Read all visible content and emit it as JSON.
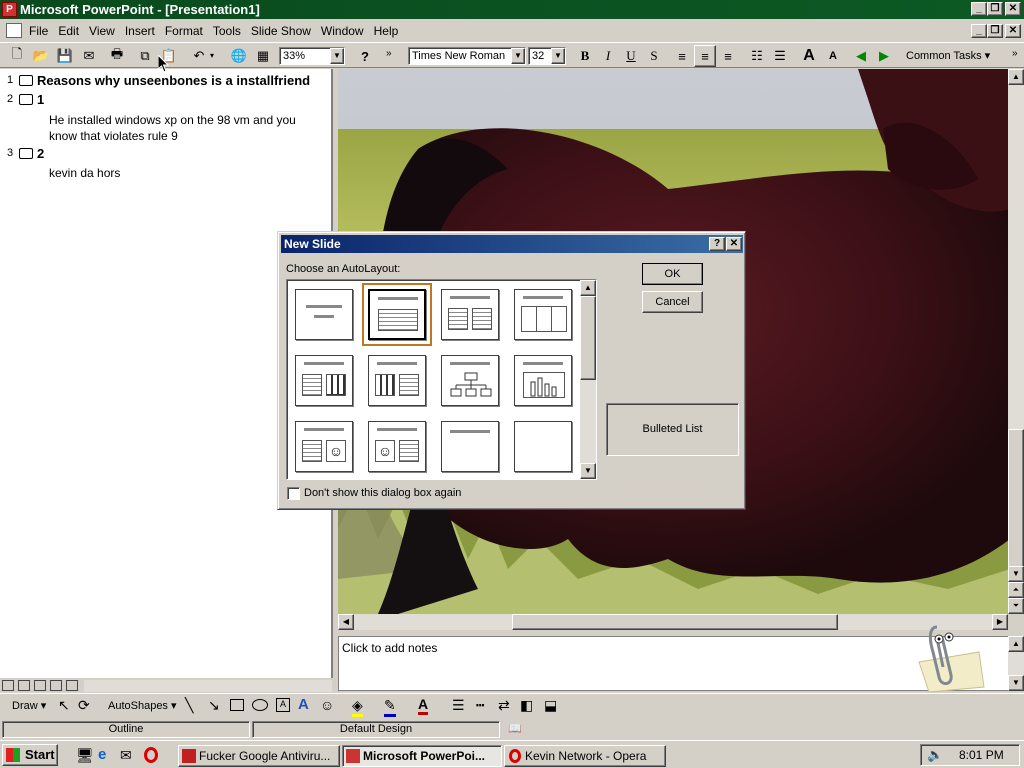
{
  "app": {
    "title": "Microsoft PowerPoint - [Presentation1]"
  },
  "menu": [
    "File",
    "Edit",
    "View",
    "Insert",
    "Format",
    "Tools",
    "Slide Show",
    "Window",
    "Help"
  ],
  "toolbar": {
    "zoom": "33%",
    "font": "Times New Roman",
    "size": "32",
    "common_tasks": "Common Tasks ▾"
  },
  "outline": {
    "slide1_num": "1",
    "slide1_title": "Reasons why unseenbones is a installfriend",
    "slide2_num": "2",
    "slide2_title": "1",
    "slide2_body": "He installed windows xp on the 98 vm and you know that violates rule 9",
    "slide3_num": "3",
    "slide3_title": "2",
    "slide3_body": "kevin da hors"
  },
  "notes": {
    "placeholder": "Click to add notes"
  },
  "dialog": {
    "title": "New Slide",
    "choose_label": "Choose an AutoLayout:",
    "ok": "OK",
    "cancel": "Cancel",
    "preview_label": "Bulleted List",
    "dont_show": "Don't show this dialog box again"
  },
  "drawbar": {
    "draw": "Draw ▾",
    "autoshapes": "AutoShapes ▾"
  },
  "status": {
    "outline": "Outline",
    "design": "Default Design"
  },
  "taskbar": {
    "start": "Start",
    "task1": "Fucker Google Antiviru...",
    "task2": "Microsoft PowerPoi...",
    "task3": "Kevin Network - Opera",
    "clock": "8:01 PM"
  },
  "colors": {
    "title_bar": "#0c5a24",
    "dialog_title": "#0a246a",
    "selection": "#c07820"
  }
}
